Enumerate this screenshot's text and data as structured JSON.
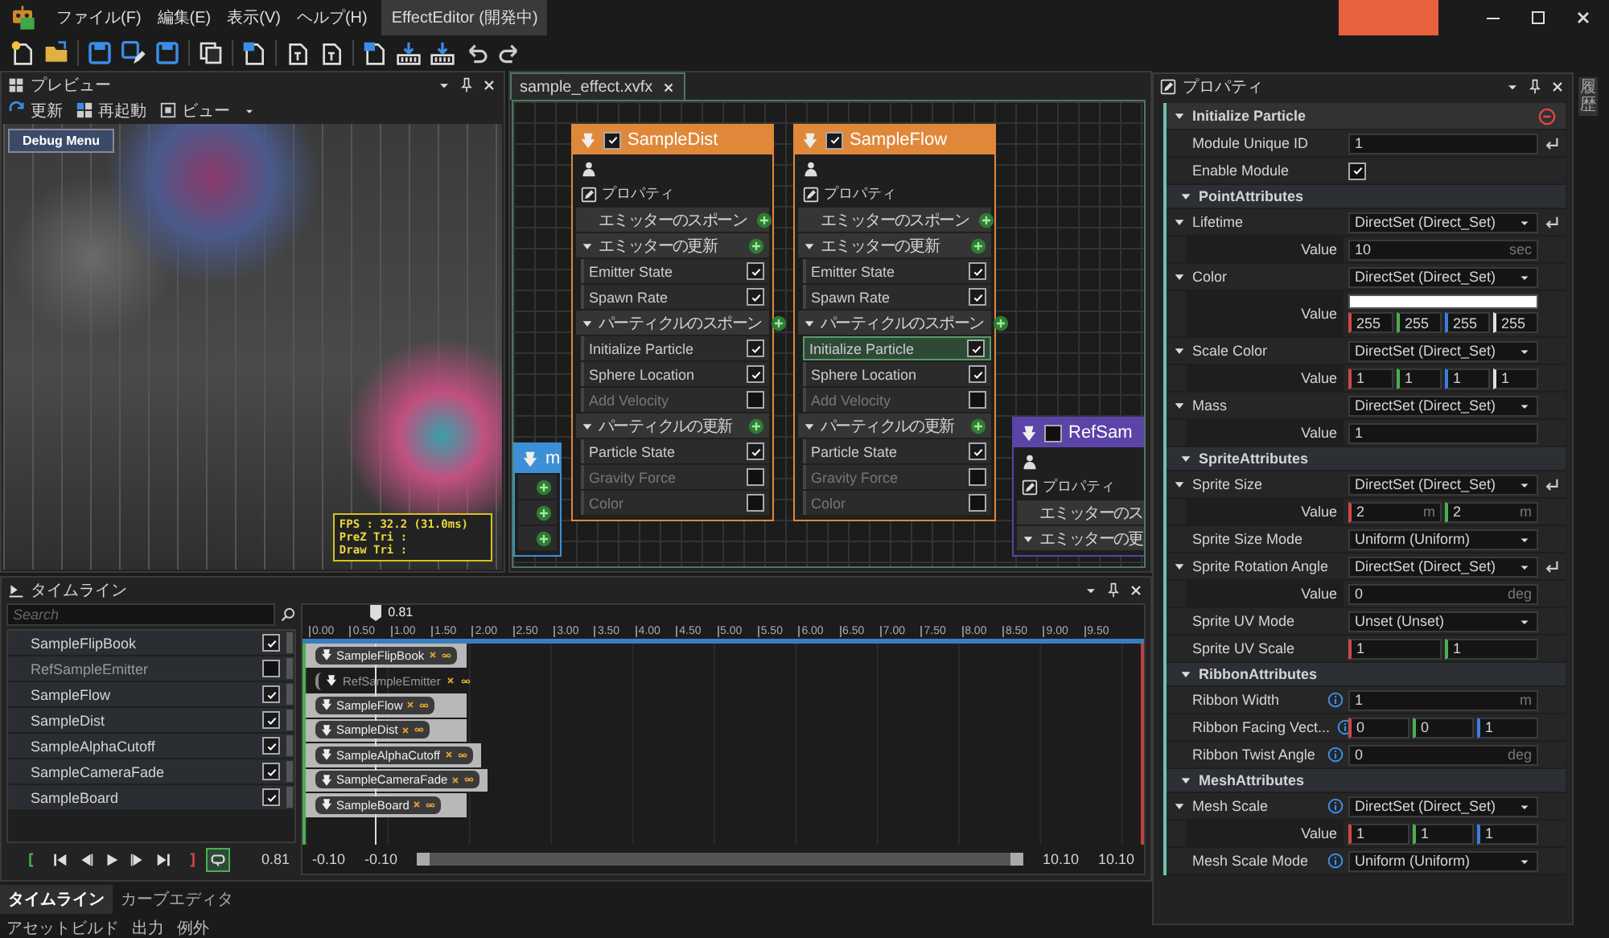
{
  "menu": {
    "items": [
      "ファイル(F)",
      "編集(E)",
      "表示(V)",
      "ヘルプ(H)"
    ],
    "title": "EffectEditor (開発中)"
  },
  "preview": {
    "title": "プレビュー",
    "tools": [
      "更新",
      "再起動",
      "ビュー"
    ],
    "debug_button": "Debug Menu",
    "stats": [
      "FPS : 32.2 (31.0ms)",
      "PreZ Tri :",
      "Draw Tri :"
    ]
  },
  "graph": {
    "tab": "sample_effect.xvfx",
    "nodes": [
      {
        "title": "SampleDist",
        "color": "#e0883a",
        "enabled": true,
        "rows": [
          {
            "kind": "person"
          },
          {
            "kind": "props",
            "label": "プロパティ"
          },
          {
            "kind": "section",
            "label": "エミッターのスポーン",
            "expanded": false
          },
          {
            "kind": "section",
            "label": "エミッターの更新",
            "expanded": true
          },
          {
            "kind": "module",
            "label": "Emitter State",
            "checked": true,
            "selected": false
          },
          {
            "kind": "module",
            "label": "Spawn Rate",
            "checked": true,
            "selected": false
          },
          {
            "kind": "section",
            "label": "パーティクルのスポーン",
            "expanded": true
          },
          {
            "kind": "module",
            "label": "Initialize Particle",
            "checked": true,
            "selected": false
          },
          {
            "kind": "module",
            "label": "Sphere Location",
            "checked": true,
            "selected": false
          },
          {
            "kind": "module",
            "label": "Add Velocity",
            "checked": false,
            "selected": false
          },
          {
            "kind": "section",
            "label": "パーティクルの更新",
            "expanded": true
          },
          {
            "kind": "module",
            "label": "Particle State",
            "checked": true,
            "selected": false
          },
          {
            "kind": "module",
            "label": "Gravity Force",
            "checked": false,
            "selected": false
          },
          {
            "kind": "module",
            "label": "Color",
            "checked": false,
            "selected": false
          }
        ]
      },
      {
        "title": "SampleFlow",
        "color": "#e0883a",
        "enabled": true,
        "rows": [
          {
            "kind": "person"
          },
          {
            "kind": "props",
            "label": "プロパティ"
          },
          {
            "kind": "section",
            "label": "エミッターのスポーン",
            "expanded": false
          },
          {
            "kind": "section",
            "label": "エミッターの更新",
            "expanded": true
          },
          {
            "kind": "module",
            "label": "Emitter State",
            "checked": true,
            "selected": false
          },
          {
            "kind": "module",
            "label": "Spawn Rate",
            "checked": true,
            "selected": false
          },
          {
            "kind": "section",
            "label": "パーティクルのスポーン",
            "expanded": true
          },
          {
            "kind": "module",
            "label": "Initialize Particle",
            "checked": true,
            "selected": true
          },
          {
            "kind": "module",
            "label": "Sphere Location",
            "checked": true,
            "selected": false
          },
          {
            "kind": "module",
            "label": "Add Velocity",
            "checked": false,
            "selected": false
          },
          {
            "kind": "section",
            "label": "パーティクルの更新",
            "expanded": true
          },
          {
            "kind": "module",
            "label": "Particle State",
            "checked": true,
            "selected": false
          },
          {
            "kind": "module",
            "label": "Gravity Force",
            "checked": false,
            "selected": false
          },
          {
            "kind": "module",
            "label": "Color",
            "checked": false,
            "selected": false
          }
        ]
      },
      {
        "title": "RefSam",
        "color": "#5b43a8",
        "enabled": false,
        "rows": [
          {
            "kind": "person"
          },
          {
            "kind": "props",
            "label": "プロパティ"
          },
          {
            "kind": "section",
            "label": "エミッターのス",
            "expanded": false
          },
          {
            "kind": "section",
            "label": "エミッターの更",
            "expanded": true
          }
        ]
      },
      {
        "title": "m",
        "color": "#3d8fd6",
        "rows": [
          {
            "kind": "stub"
          },
          {
            "kind": "stub"
          },
          {
            "kind": "stub"
          }
        ]
      }
    ]
  },
  "properties": {
    "title": "プロパティ",
    "rows": [
      {
        "kind": "module",
        "label": "Initialize Particle"
      },
      {
        "kind": "field",
        "label": "Module Unique ID",
        "values": [
          "1"
        ],
        "reset": true
      },
      {
        "kind": "check",
        "label": "Enable Module",
        "checked": true
      },
      {
        "kind": "group",
        "label": "PointAttributes"
      },
      {
        "kind": "dropdown",
        "label": "Lifetime",
        "value": "DirectSet (Direct_Set)",
        "expanded": true,
        "reset": true
      },
      {
        "kind": "value",
        "label": "Value",
        "values": [
          "10"
        ],
        "units": [
          "sec"
        ]
      },
      {
        "kind": "dropdown",
        "label": "Color",
        "value": "DirectSet (Direct_Set)",
        "expanded": true
      },
      {
        "kind": "color",
        "label": "Value",
        "values": [
          "255",
          "255",
          "255",
          "255"
        ]
      },
      {
        "kind": "dropdown",
        "label": "Scale Color",
        "value": "DirectSet (Direct_Set)",
        "expanded": true
      },
      {
        "kind": "value",
        "label": "Value",
        "values": [
          "1",
          "1",
          "1",
          "1"
        ]
      },
      {
        "kind": "dropdown",
        "label": "Mass",
        "value": "DirectSet (Direct_Set)",
        "expanded": true
      },
      {
        "kind": "value",
        "label": "Value",
        "values": [
          "1"
        ]
      },
      {
        "kind": "group",
        "label": "SpriteAttributes"
      },
      {
        "kind": "dropdown",
        "label": "Sprite Size",
        "value": "DirectSet (Direct_Set)",
        "expanded": true,
        "reset": true
      },
      {
        "kind": "value",
        "label": "Value",
        "values": [
          "2",
          "2"
        ],
        "units": [
          "m",
          "m"
        ]
      },
      {
        "kind": "dropdown",
        "label": "Sprite Size Mode",
        "value": "Uniform (Uniform)"
      },
      {
        "kind": "dropdown",
        "label": "Sprite Rotation Angle",
        "value": "DirectSet (Direct_Set)",
        "expanded": true,
        "reset": true
      },
      {
        "kind": "value",
        "label": "Value",
        "values": [
          "0"
        ],
        "units": [
          "deg"
        ]
      },
      {
        "kind": "dropdown",
        "label": "Sprite UV Mode",
        "value": "Unset (Unset)"
      },
      {
        "kind": "field",
        "label": "Sprite UV Scale",
        "values": [
          "1",
          "1"
        ]
      },
      {
        "kind": "group",
        "label": "RibbonAttributes"
      },
      {
        "kind": "field",
        "label": "Ribbon Width",
        "values": [
          "1"
        ],
        "units": [
          "m"
        ],
        "info": true
      },
      {
        "kind": "field",
        "label": "Ribbon Facing Vect...",
        "values": [
          "0",
          "0",
          "1"
        ],
        "info": true
      },
      {
        "kind": "field",
        "label": "Ribbon Twist Angle",
        "values": [
          "0"
        ],
        "units": [
          "deg"
        ],
        "info": true
      },
      {
        "kind": "group",
        "label": "MeshAttributes"
      },
      {
        "kind": "dropdown",
        "label": "Mesh Scale",
        "value": "DirectSet (Direct_Set)",
        "expanded": true,
        "info": true
      },
      {
        "kind": "value",
        "label": "Value",
        "values": [
          "1",
          "1",
          "1"
        ]
      },
      {
        "kind": "dropdown",
        "label": "Mesh Scale Mode",
        "value": "Uniform (Uniform)",
        "info": true
      }
    ]
  },
  "timeline": {
    "title": "タイムライン",
    "search": {
      "placeholder": "Search"
    },
    "tracks": [
      {
        "name": "SampleFlipBook",
        "checked": true,
        "clip": "SampleFlipBook"
      },
      {
        "name": "RefSampleEmitter",
        "checked": false,
        "clip": "RefSampleEmitter"
      },
      {
        "name": "SampleFlow",
        "checked": true,
        "clip": "SampleFlow"
      },
      {
        "name": "SampleDist",
        "checked": true,
        "clip": "SampleDist"
      },
      {
        "name": "SampleAlphaCutoff",
        "checked": true,
        "clip": "SampleAlphaCutoff"
      },
      {
        "name": "SampleCameraFade",
        "checked": true,
        "clip": "SampleCameraFade"
      },
      {
        "name": "SampleBoard",
        "checked": true,
        "clip": "SampleBoard"
      }
    ],
    "current_time": "0.81",
    "playhead": {
      "label": "0.81",
      "level": 0.081
    },
    "ticks": [
      "0.00",
      "0.50",
      "1.00",
      "1.50",
      "2.00",
      "2.50",
      "3.00",
      "3.50",
      "4.00",
      "4.50",
      "5.00",
      "5.50",
      "6.00",
      "6.50",
      "7.00",
      "7.50",
      "8.00",
      "8.50",
      "9.00",
      "9.50"
    ],
    "range_start": [
      "-0.10",
      "-0.10"
    ],
    "range_end": [
      "10.10",
      "10.10"
    ]
  },
  "bottom_tabs": [
    {
      "label": "タイムライン",
      "selected": true
    },
    {
      "label": "カーブエディタ",
      "selected": false
    }
  ],
  "output_tabs": [
    "アセットビルド",
    "出力",
    "例外"
  ],
  "side_strip": {
    "label": "履歴"
  }
}
